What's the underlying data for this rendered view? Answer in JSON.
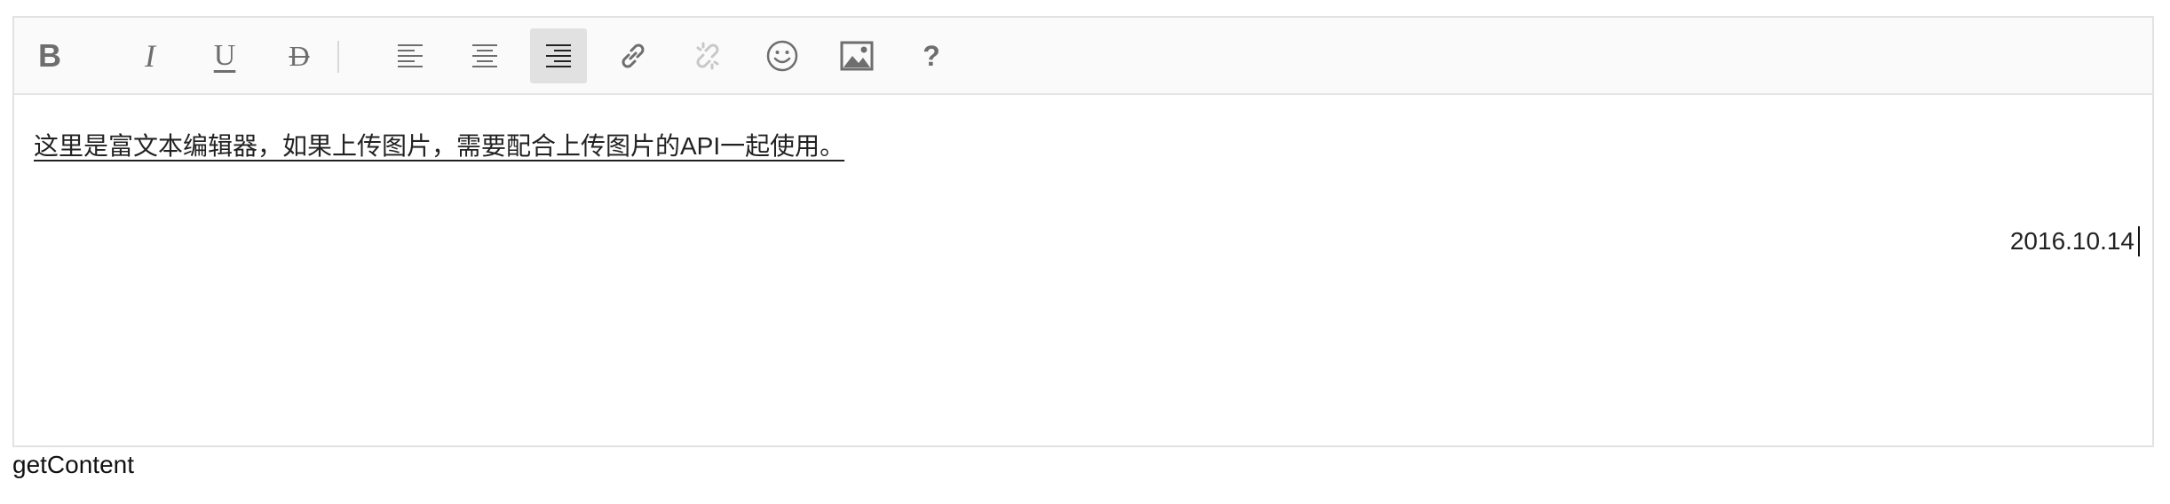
{
  "toolbar": {
    "buttons": [
      {
        "name": "bold",
        "glyph": "B",
        "icon": "bold-icon"
      },
      {
        "name": "italic",
        "glyph": "I",
        "icon": "italic-icon"
      },
      {
        "name": "underline",
        "glyph": "U",
        "icon": "underline-icon"
      },
      {
        "name": "strikethrough",
        "glyph": "D",
        "icon": "strikethrough-icon"
      },
      {
        "name": "align-left",
        "icon": "align-left-icon"
      },
      {
        "name": "align-center",
        "icon": "align-center-icon"
      },
      {
        "name": "align-right",
        "icon": "align-right-icon",
        "active": true
      },
      {
        "name": "link",
        "icon": "link-icon"
      },
      {
        "name": "unlink",
        "icon": "unlink-icon",
        "disabled": true
      },
      {
        "name": "emoji",
        "icon": "smiley-icon"
      },
      {
        "name": "image",
        "icon": "image-icon"
      },
      {
        "name": "help",
        "glyph": "?",
        "icon": "help-icon"
      }
    ]
  },
  "content": {
    "line1": "这里是富文本编辑器，如果上传图片，需要配合上传图片的API一起使用。",
    "line2": "2016.10.14"
  },
  "footer": {
    "link": "getContent"
  },
  "colors": {
    "icon": "#6e6e6e",
    "icon_disabled": "#c8c8c8",
    "active_bg": "#e1e1e1",
    "toolbar_bg": "#fafafa",
    "border": "#e2e2e2"
  }
}
